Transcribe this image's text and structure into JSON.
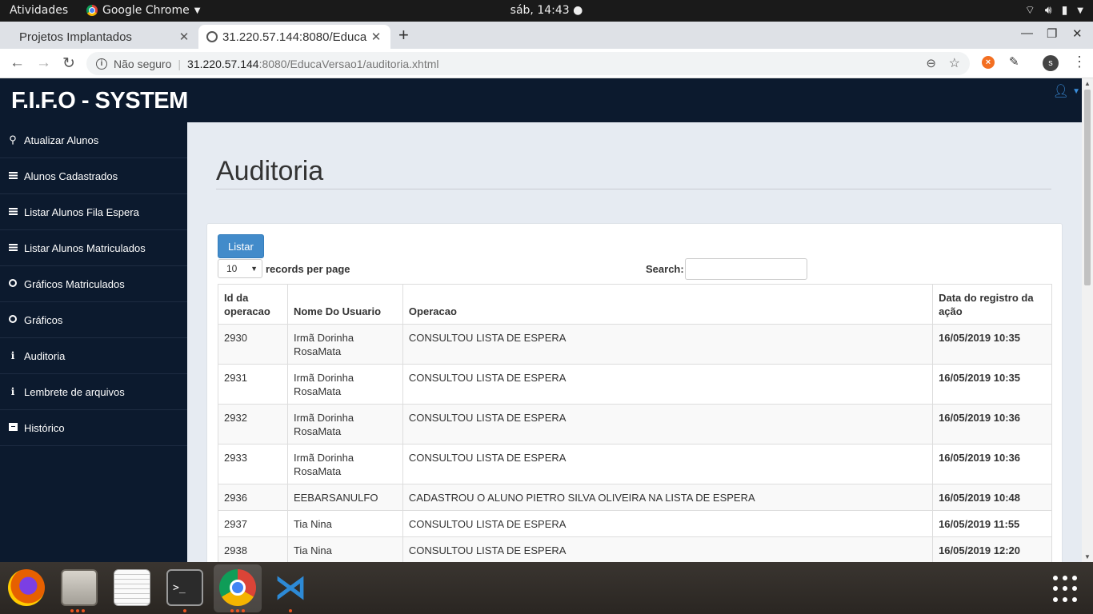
{
  "gnome": {
    "activities": "Atividades",
    "app_menu": "Google Chrome",
    "clock": "sáb, 14:43 ●"
  },
  "browser": {
    "tabs": [
      {
        "title": "Projetos Implantados"
      },
      {
        "title": "31.220.57.144:8080/Educa"
      }
    ],
    "security_label": "Não seguro",
    "url_host": "31.220.57.144",
    "url_path": ":8080/EducaVersao1/auditoria.xhtml",
    "profile_initial": "s"
  },
  "site": {
    "brand": "F.I.F.O - SYSTEM"
  },
  "sidebar": {
    "items": [
      {
        "label": "Atualizar Alunos",
        "icon": "search-icon"
      },
      {
        "label": "Alunos Cadastrados",
        "icon": "list-icon"
      },
      {
        "label": "Listar Alunos Fila Espera",
        "icon": "list-icon"
      },
      {
        "label": "Listar Alunos Matriculados",
        "icon": "list-icon"
      },
      {
        "label": "Gráficos Matriculados",
        "icon": "circle-icon"
      },
      {
        "label": "Gráficos",
        "icon": "circle-icon"
      },
      {
        "label": "Auditoria",
        "icon": "info-icon"
      },
      {
        "label": "Lembrete de arquivos",
        "icon": "info-icon"
      },
      {
        "label": "Histórico",
        "icon": "archive-icon"
      }
    ]
  },
  "main": {
    "title": "Auditoria",
    "listar_button": "Listar",
    "length_value": "10",
    "records_label": "records per page",
    "search_label": "Search:",
    "search_value": ""
  },
  "table": {
    "headers": {
      "id": "Id da operacao",
      "user": "Nome Do Usuario",
      "op": "Operacao",
      "date": "Data do registro da ação"
    },
    "rows": [
      {
        "id": "2930",
        "user": "Irmã Dorinha RosaMata",
        "op": "CONSULTOU LISTA DE ESPERA",
        "date": "16/05/2019 10:35"
      },
      {
        "id": "2931",
        "user": "Irmã Dorinha RosaMata",
        "op": "CONSULTOU LISTA DE ESPERA",
        "date": "16/05/2019 10:35"
      },
      {
        "id": "2932",
        "user": "Irmã Dorinha RosaMata",
        "op": "CONSULTOU LISTA DE ESPERA",
        "date": "16/05/2019 10:36"
      },
      {
        "id": "2933",
        "user": "Irmã Dorinha RosaMata",
        "op": "CONSULTOU LISTA DE ESPERA",
        "date": "16/05/2019 10:36"
      },
      {
        "id": "2936",
        "user": "EEBARSANULFO",
        "op": "CADASTROU O ALUNO PIETRO SILVA OLIVEIRA NA LISTA DE ESPERA",
        "date": "16/05/2019 10:48"
      },
      {
        "id": "2937",
        "user": "Tia Nina",
        "op": "CONSULTOU LISTA DE ESPERA",
        "date": "16/05/2019 11:55"
      },
      {
        "id": "2938",
        "user": "Tia Nina",
        "op": "CONSULTOU LISTA DE ESPERA",
        "date": "16/05/2019 12:20"
      }
    ]
  },
  "colors": {
    "header_bg": "#0c1a2e",
    "content_bg": "#e6ebf2",
    "primary_button": "#428bca"
  }
}
